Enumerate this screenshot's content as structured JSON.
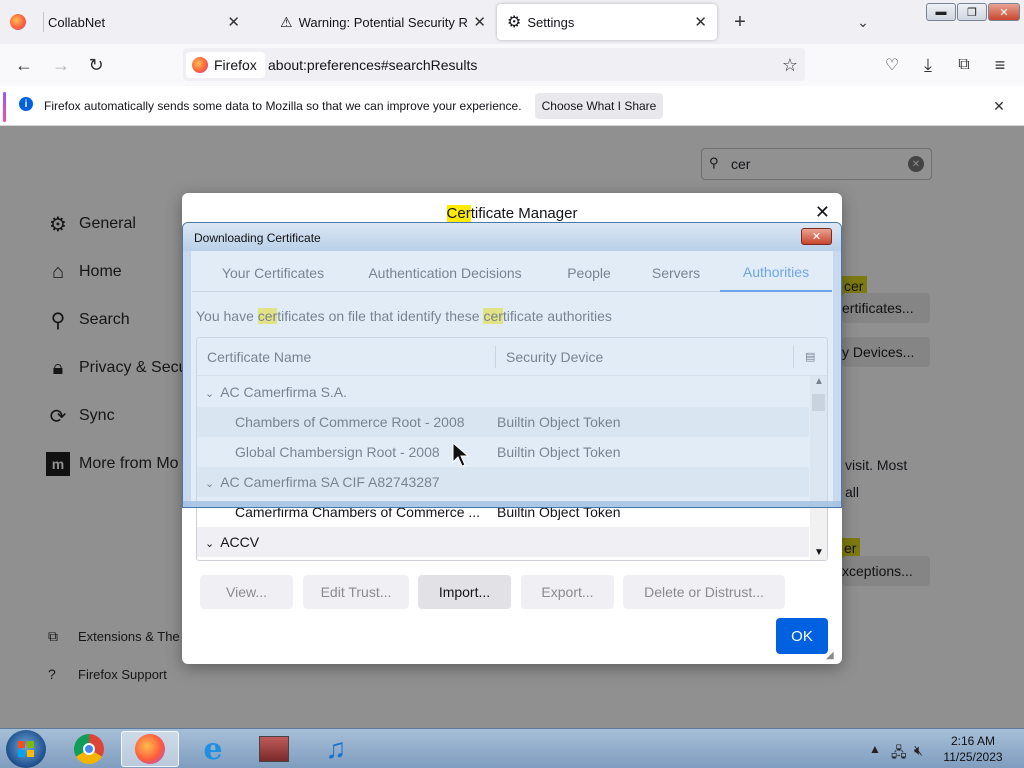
{
  "tabs": [
    {
      "label": "CollabNet"
    },
    {
      "label": "Warning: Potential Security Risk"
    },
    {
      "label": "Settings"
    }
  ],
  "address": {
    "identity": "Firefox",
    "url": "about:preferences#searchResults"
  },
  "notification": {
    "text": "Firefox automatically sends some data to Mozilla so that we can improve your experience.",
    "button": "Choose What I Share"
  },
  "settings": {
    "search_value": "cer",
    "sidebar": [
      {
        "label": "General"
      },
      {
        "label": "Home"
      },
      {
        "label": "Search"
      },
      {
        "label": "Privacy & Secu"
      },
      {
        "label": "Sync"
      },
      {
        "label": "More from Mo"
      }
    ],
    "footer": [
      {
        "label": "Extensions & The"
      },
      {
        "label": "Firefox Support"
      }
    ],
    "bg_fragments": {
      "cer_badge_1": "cer",
      "certificates_btn": "ertificates...",
      "devices_btn": "y Devices...",
      "visit_text_1": "visit. Most",
      "visit_text_2": "all",
      "cer_badge_2": "er",
      "exceptions_btn": "xceptions..."
    }
  },
  "cert_manager": {
    "title_highlight": "Cer",
    "title_rest": "tificate Manager",
    "tabs": [
      {
        "label": "Your Certificates"
      },
      {
        "label": "Authentication Decisions"
      },
      {
        "label": "People"
      },
      {
        "label": "Servers"
      },
      {
        "label": "Authorities"
      }
    ],
    "desc": {
      "p1": "You have ",
      "h1": "cer",
      "p2": "tificates on file that identify these ",
      "h2": "cer",
      "p3": "tificate authorities"
    },
    "columns": [
      "Certificate Name",
      "Security Device"
    ],
    "rows": [
      {
        "name": "AC Camerfirma S.A.",
        "device": ""
      },
      {
        "name": "Chambers of Commerce Root - 2008",
        "device": "Builtin Object Token"
      },
      {
        "name": "Global Chambersign Root - 2008",
        "device": "Builtin Object Token"
      },
      {
        "name": "AC Camerfirma SA CIF A82743287",
        "device": ""
      },
      {
        "name": "Camerfirma Chambers of Commerce ...",
        "device": "Builtin Object Token"
      },
      {
        "name": "ACCV",
        "device": ""
      }
    ],
    "buttons": {
      "view": "View...",
      "edit": "Edit Trust...",
      "import": "Import...",
      "export": "Export...",
      "delete": "Delete or Distrust...",
      "ok": "OK"
    }
  },
  "download_window": {
    "title": "Downloading Certificate"
  },
  "taskbar": {
    "time": "2:16 AM",
    "date": "11/25/2023"
  }
}
